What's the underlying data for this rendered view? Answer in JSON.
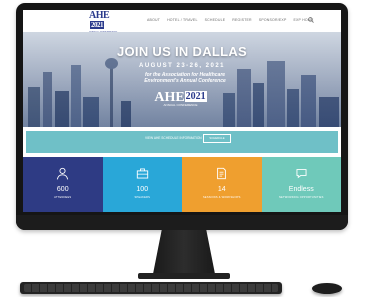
{
  "navbar": {
    "logo": {
      "mark": "AHE",
      "year": "2021",
      "sub": "ANNUAL CONFERENCE"
    },
    "items": [
      "ABOUT",
      "HOTEL / TRAVEL",
      "SCHEDULE",
      "REGISTER",
      "SPONSOR/EXP",
      "EXP HOME"
    ]
  },
  "hero": {
    "title": "JOIN US IN DALLAS",
    "date": "AUGUST 23-26, 2021",
    "subtitle": "for the Association for Healthcare Environment's Annual Conference",
    "logo": {
      "mark": "AHE",
      "year": "2021",
      "sub": "ANNUAL CONFERENCE"
    }
  },
  "banner": {
    "text": "VIEW AHE SCHEDULE INFORMATION",
    "button": "SCHEDULE"
  },
  "tiles": [
    {
      "value": "600",
      "label": "ATTENDEES",
      "color": "#2e3b84",
      "icon": "person-icon"
    },
    {
      "value": "100",
      "label": "SPEAKERS",
      "color": "#29a7d8",
      "icon": "briefcase-icon"
    },
    {
      "value": "14",
      "label": "SESSIONS & WORKSHOPS",
      "color": "#ef9f2f",
      "icon": "document-icon"
    },
    {
      "value": "Endless",
      "label": "NETWORKING OPPORTUNITIES",
      "color": "#6fc9ba",
      "icon": "chat-icon"
    }
  ]
}
